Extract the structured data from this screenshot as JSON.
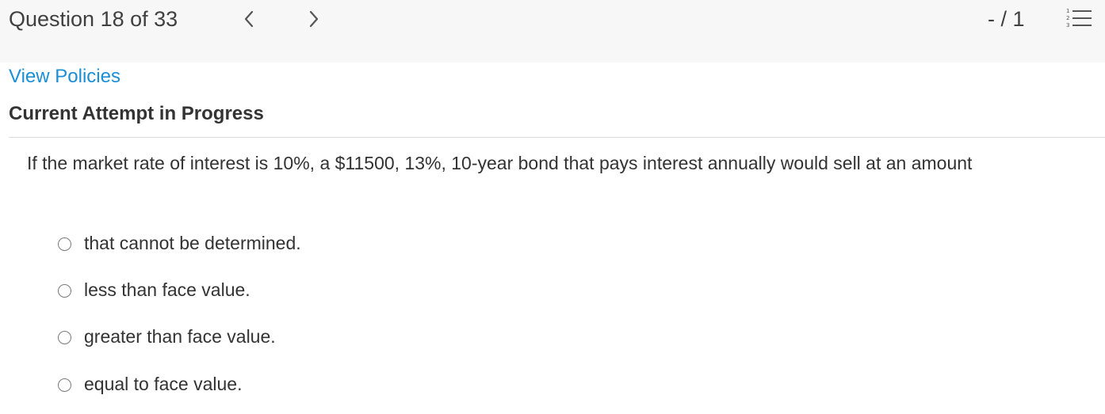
{
  "header": {
    "question_counter": "Question 18 of 33",
    "prev_icon": "chevron-left-icon",
    "next_icon": "chevron-right-icon",
    "score": "- / 1",
    "list_icon": "numbered-list-icon"
  },
  "policies_link": "View Policies",
  "attempt_heading": "Current Attempt in Progress",
  "question": {
    "text": "If the market rate of interest is 10%, a $11500, 13%, 10-year bond that pays interest annually would sell at an amount",
    "options": [
      {
        "label": "that cannot be determined.",
        "selected": false
      },
      {
        "label": "less than face value.",
        "selected": false
      },
      {
        "label": "greater than face value.",
        "selected": false
      },
      {
        "label": "equal to face value.",
        "selected": false
      }
    ]
  },
  "colors": {
    "topbar_bg": "#f7f7f7",
    "link": "#1a8fd6",
    "text": "#333333",
    "divider": "#dddddd"
  }
}
